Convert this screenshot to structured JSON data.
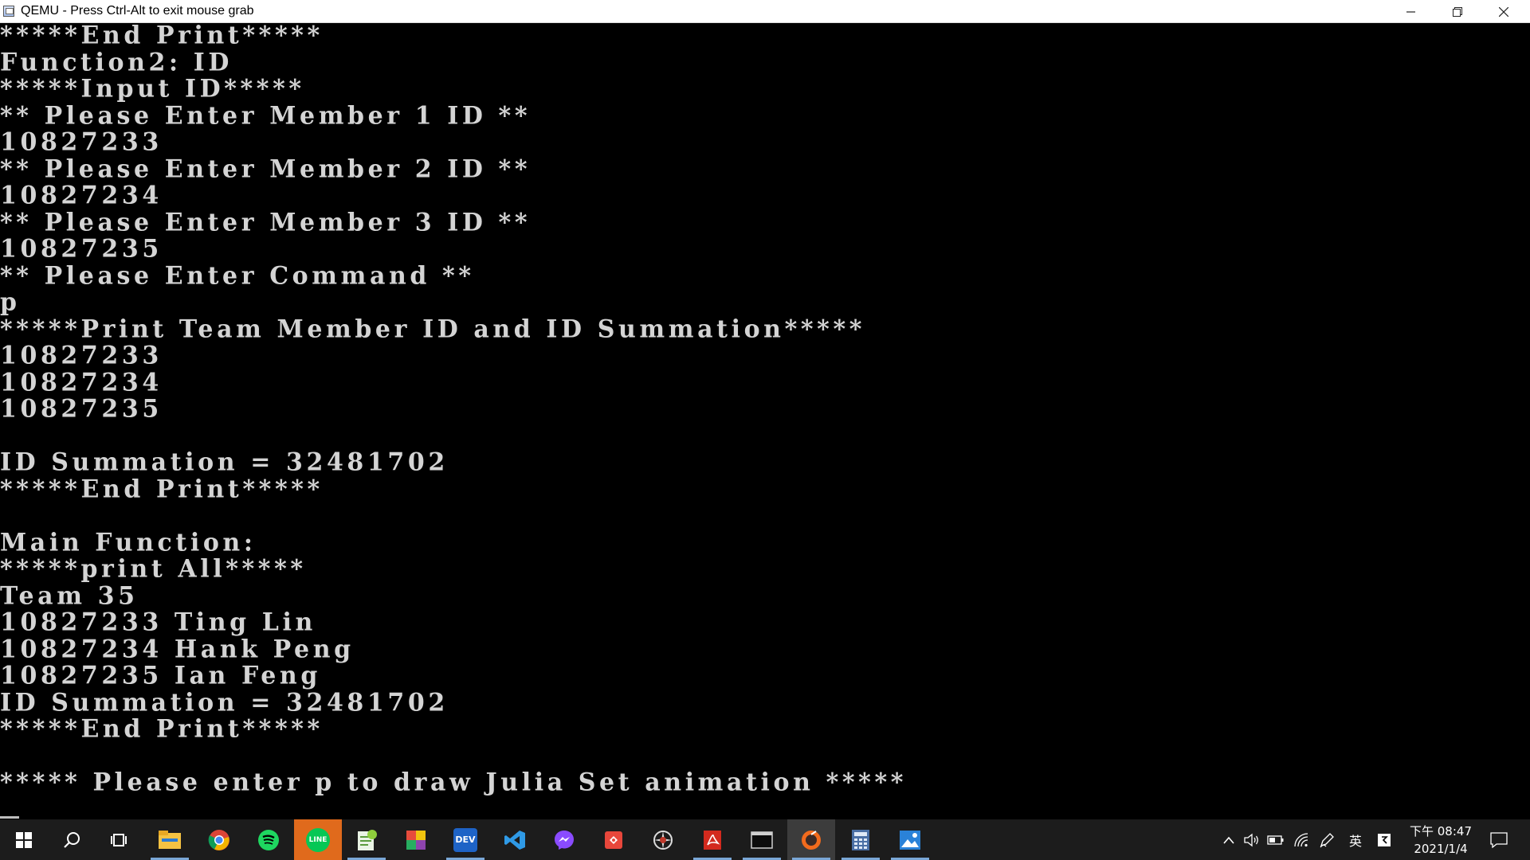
{
  "window": {
    "title": "QEMU - Press Ctrl-Alt to exit mouse grab"
  },
  "console": {
    "lines": [
      "*****End Print*****",
      "Function2: ID",
      "*****Input ID*****",
      "** Please Enter Member 1 ID **",
      "10827233",
      "** Please Enter Member 2 ID **",
      "10827234",
      "** Please Enter Member 3 ID **",
      "10827235",
      "** Please Enter Command **",
      "p",
      "*****Print Team Member ID and ID Summation*****",
      "10827233",
      "10827234",
      "10827235",
      "",
      "ID Summation = 32481702",
      "*****End Print*****",
      "",
      "Main Function:",
      "*****print All*****",
      "Team 35",
      "10827233 Ting Lin",
      "10827234 Hank Peng",
      "10827235 Ian Feng",
      "ID Summation = 32481702",
      "*****End Print*****",
      "",
      "***** Please enter p to draw Julia Set animation *****"
    ]
  },
  "taskbar": {
    "apps": [
      {
        "name": "start-icon"
      },
      {
        "name": "search-icon"
      },
      {
        "name": "task-view-icon"
      },
      {
        "name": "file-explorer-icon"
      },
      {
        "name": "chrome-icon"
      },
      {
        "name": "spotify-icon"
      },
      {
        "name": "line-icon",
        "label": "LINE"
      },
      {
        "name": "notepad-plus-icon"
      },
      {
        "name": "colorful-app-icon"
      },
      {
        "name": "dev-cpp-icon",
        "label": "DEV"
      },
      {
        "name": "vscode-icon"
      },
      {
        "name": "messenger-icon"
      },
      {
        "name": "git-icon"
      },
      {
        "name": "settings-wheel-icon"
      },
      {
        "name": "acrobat-icon"
      },
      {
        "name": "terminal-icon"
      },
      {
        "name": "qemu-icon"
      },
      {
        "name": "calculator-icon"
      },
      {
        "name": "photos-icon"
      }
    ],
    "tray": {
      "ime_label": "英",
      "time": "下午 08:47",
      "date": "2021/1/4"
    }
  },
  "colors": {
    "console_bg": "#000000",
    "console_fg": "#d4d4d4",
    "taskbar_bg": "#1c1c1c",
    "line_green": "#06c755",
    "line_highlight": "#e06a1c"
  }
}
